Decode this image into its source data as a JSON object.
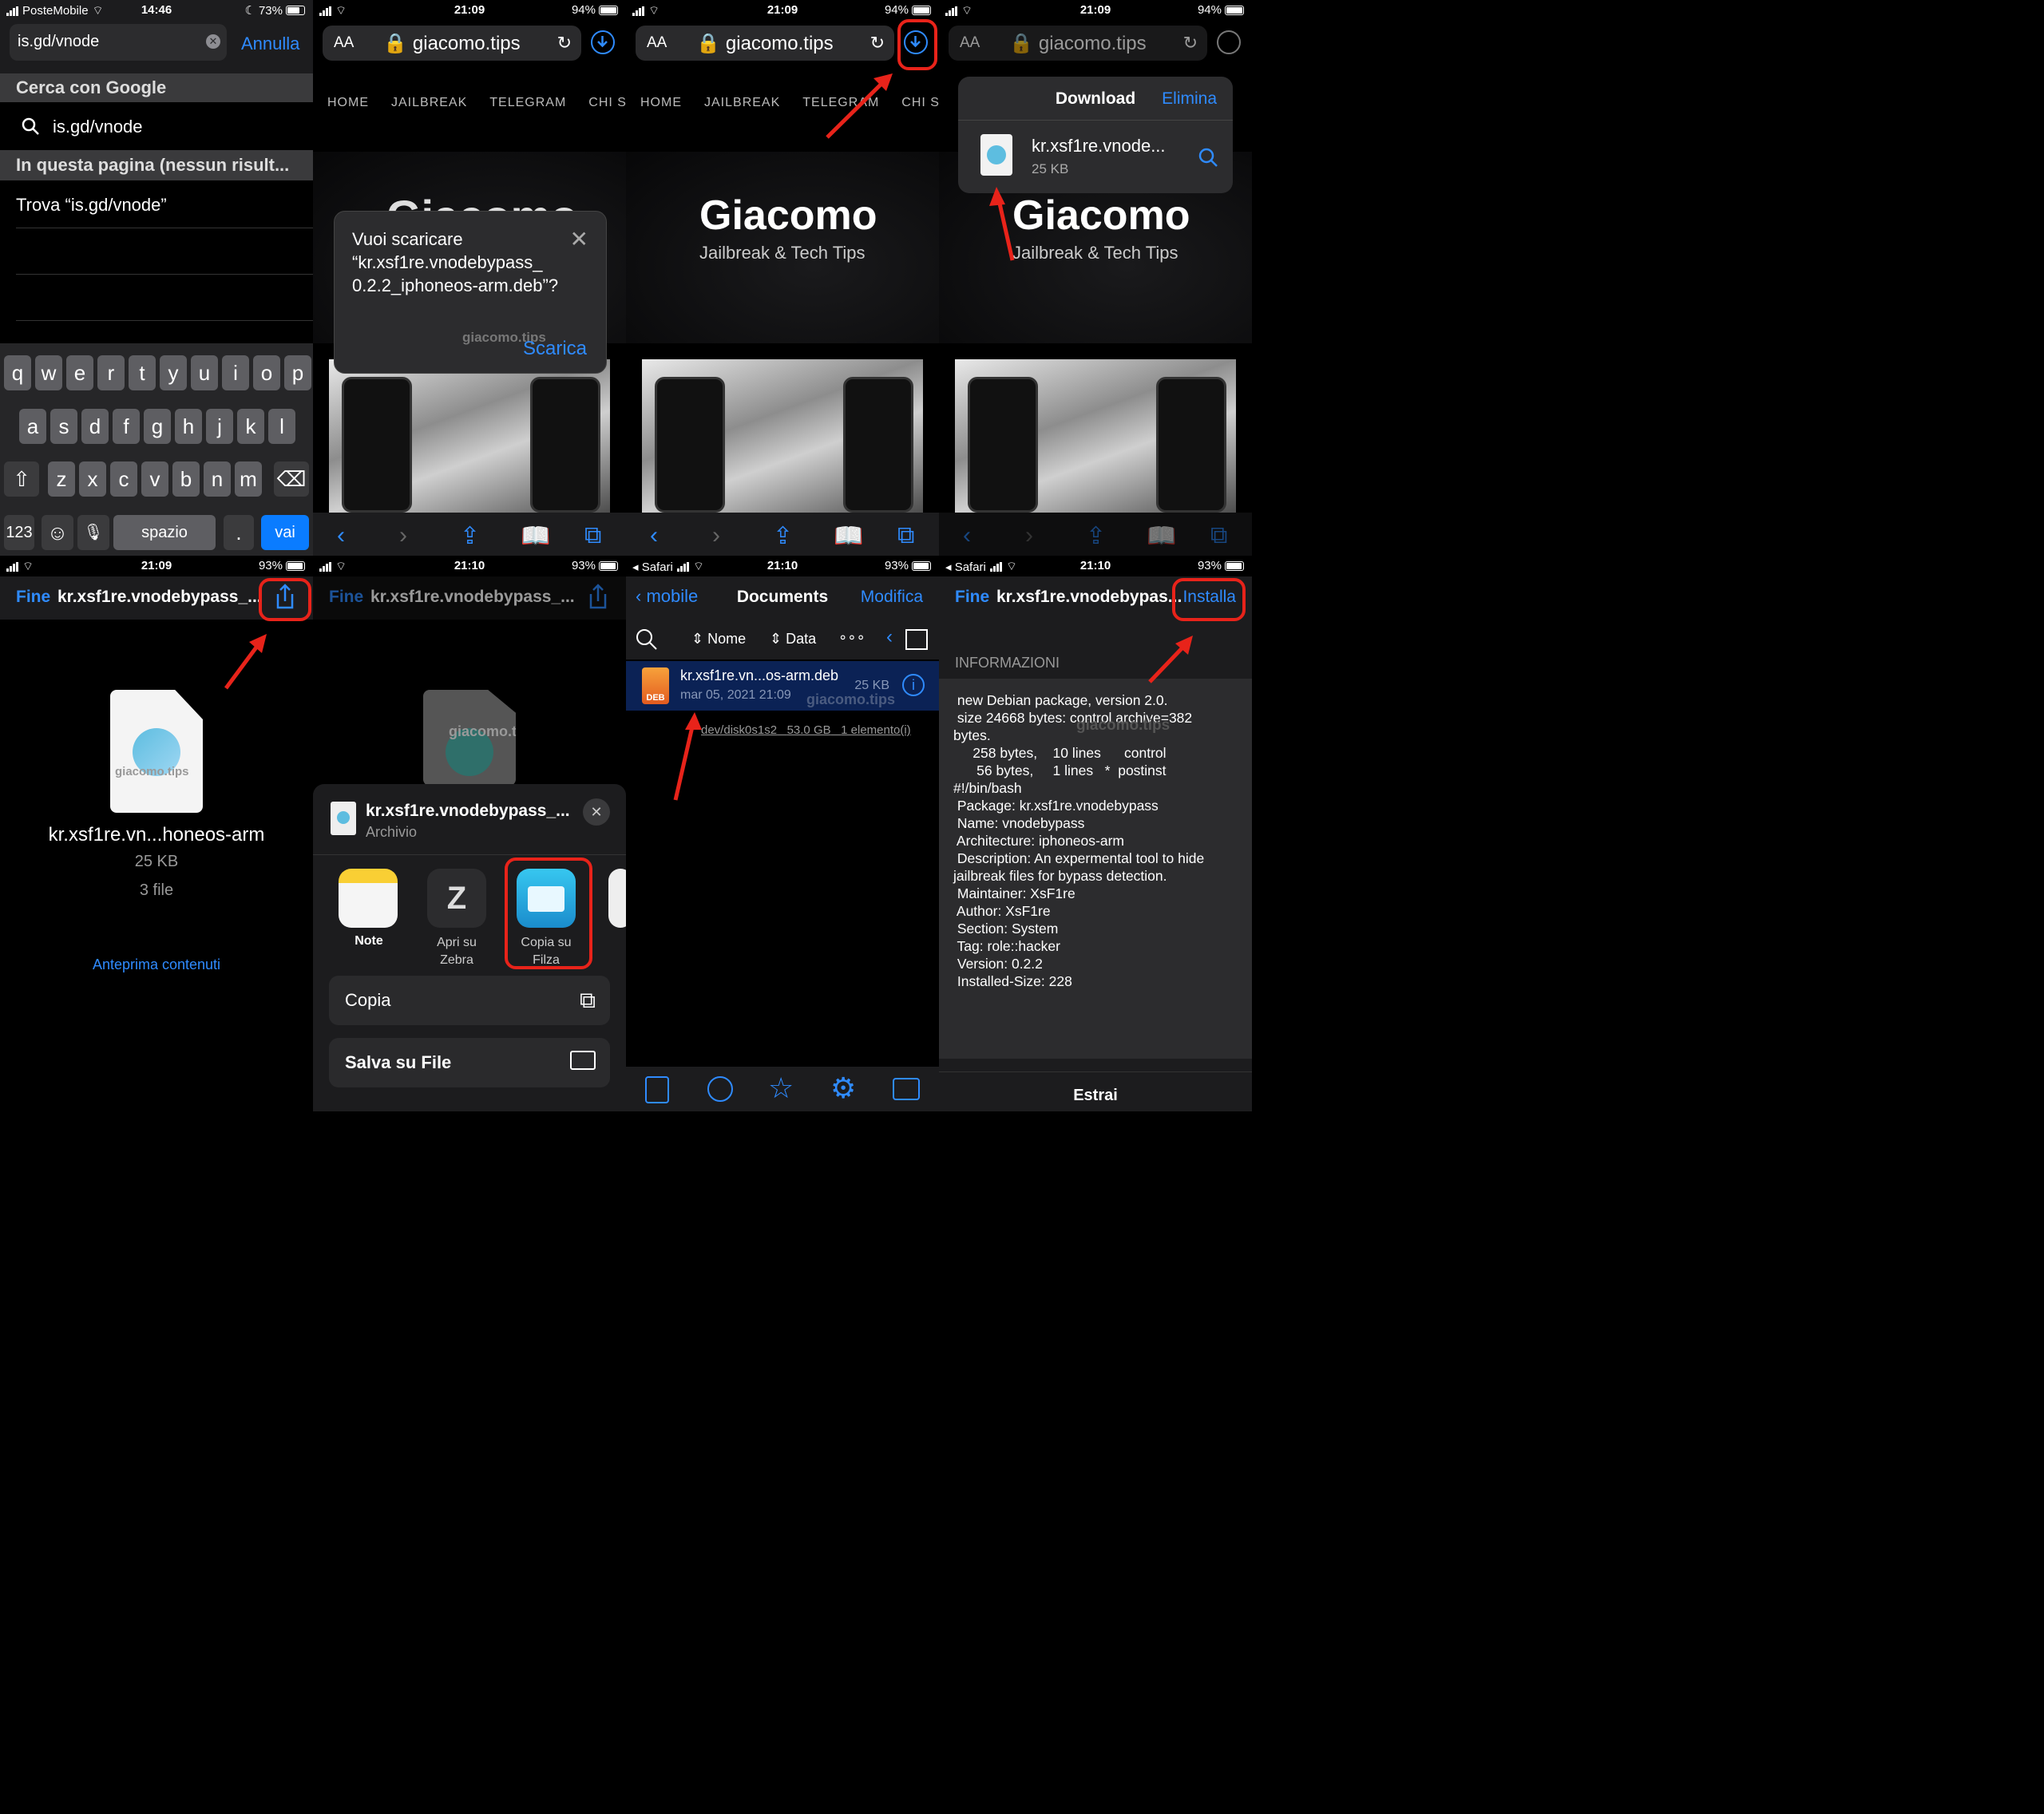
{
  "p1": {
    "status": {
      "carrier": "PosteMobile",
      "time": "14:46",
      "battery": "73%"
    },
    "search": {
      "query": "is.gd/vnode",
      "cancel": "Annulla"
    },
    "google_header": "Cerca con Google",
    "google_result": "is.gd/vnode",
    "page_header": "In questa pagina (nessun risult...",
    "find_text": "Trova “is.gd/vnode”",
    "keyboard": {
      "row1": [
        "q",
        "w",
        "e",
        "r",
        "t",
        "y",
        "u",
        "i",
        "o",
        "p"
      ],
      "row2": [
        "a",
        "s",
        "d",
        "f",
        "g",
        "h",
        "j",
        "k",
        "l"
      ],
      "row3": [
        "z",
        "x",
        "c",
        "v",
        "b",
        "n",
        "m"
      ],
      "num": "123",
      "space": "spazio",
      "dot": ".",
      "go": "vai"
    }
  },
  "p2": {
    "status": {
      "time": "21:09",
      "battery": "94%"
    },
    "aa": "AA",
    "domain": "giacomo.tips",
    "nav": [
      "HOME",
      "JAILBREAK",
      "TELEGRAM",
      "CHI S"
    ],
    "dialog": {
      "text": "Vuoi scaricare “kr.xsf1re.vnodebypass_ 0.2.2_iphoneos-arm.deb”?",
      "watermark": "giacomo.tips",
      "action": "Scarica"
    },
    "hero_title": "Giacomo"
  },
  "p3": {
    "status": {
      "time": "21:09",
      "battery": "94%"
    },
    "aa": "AA",
    "domain": "giacomo.tips",
    "nav": [
      "HOME",
      "JAILBREAK",
      "TELEGRAM",
      "CHI S"
    ],
    "hero_title": "Giacomo",
    "hero_sub": "Jailbreak & Tech Tips"
  },
  "p4": {
    "status": {
      "time": "21:09",
      "battery": "94%"
    },
    "aa": "AA",
    "domain": "giacomo.tips",
    "popover": {
      "title": "Download",
      "clear": "Elimina",
      "filename": "kr.xsf1re.vnode...",
      "size": "25 KB"
    },
    "hero_title": "Giacomo",
    "hero_sub": "Jailbreak & Tech Tips"
  },
  "p5": {
    "status": {
      "time": "21:09",
      "battery": "93%"
    },
    "done": "Fine",
    "title": "kr.xsf1re.vnodebypass_...",
    "filename": "kr.xsf1re.vn...honeos-arm",
    "size": "25 KB",
    "files": "3 file",
    "preview": "Anteprima contenuti",
    "watermark": "giacomo.tips"
  },
  "p6": {
    "status": {
      "time": "21:10",
      "battery": "93%"
    },
    "done": "Fine",
    "title": "kr.xsf1re.vnodebypass_...",
    "sheet": {
      "filename": "kr.xsf1re.vnodebypass_...",
      "kind": "Archivio",
      "apps": [
        "Note",
        "Apri su Zebra",
        "Copia su Filza"
      ],
      "actions": [
        "Copia",
        "Salva su File"
      ]
    },
    "watermark": "giacomo.tips"
  },
  "p7": {
    "status": {
      "back_app": "Safari",
      "time": "21:10",
      "battery": "93%"
    },
    "back": "mobile",
    "title": "Documents",
    "edit": "Modifica",
    "sort": [
      "Nome",
      "Data"
    ],
    "file": {
      "name": "kr.xsf1re.vn...os-arm.deb",
      "date": "mar 05, 2021 21:09",
      "size": "25 KB",
      "badge": "DEB"
    },
    "footer": [
      "dev/disk0s1s2",
      "53.0 GB",
      "1 elemento(i)"
    ],
    "watermark": "giacomo.tips"
  },
  "p8": {
    "status": {
      "back_app": "Safari",
      "time": "21:10",
      "battery": "93%"
    },
    "done": "Fine",
    "title": "kr.xsf1re.vnodebypas...",
    "install": "Installa",
    "section": "INFORMAZIONI",
    "info": " new Debian package, version 2.0.\n size 24668 bytes: control archive=382\nbytes.\n     258 bytes,    10 lines      control\n      56 bytes,     1 lines   *  postinst\n#!/bin/bash\n Package: kr.xsf1re.vnodebypass\n Name: vnodebypass\n Architecture: iphoneos-arm\n Description: An expermental tool to hide\njailbreak files for bypass detection.\n Maintainer: XsF1re\n Author: XsF1re\n Section: System\n Tag: role::hacker\n Version: 0.2.2\n Installed-Size: 228",
    "extract": "Estrai",
    "watermark": "giacomo.tips"
  }
}
